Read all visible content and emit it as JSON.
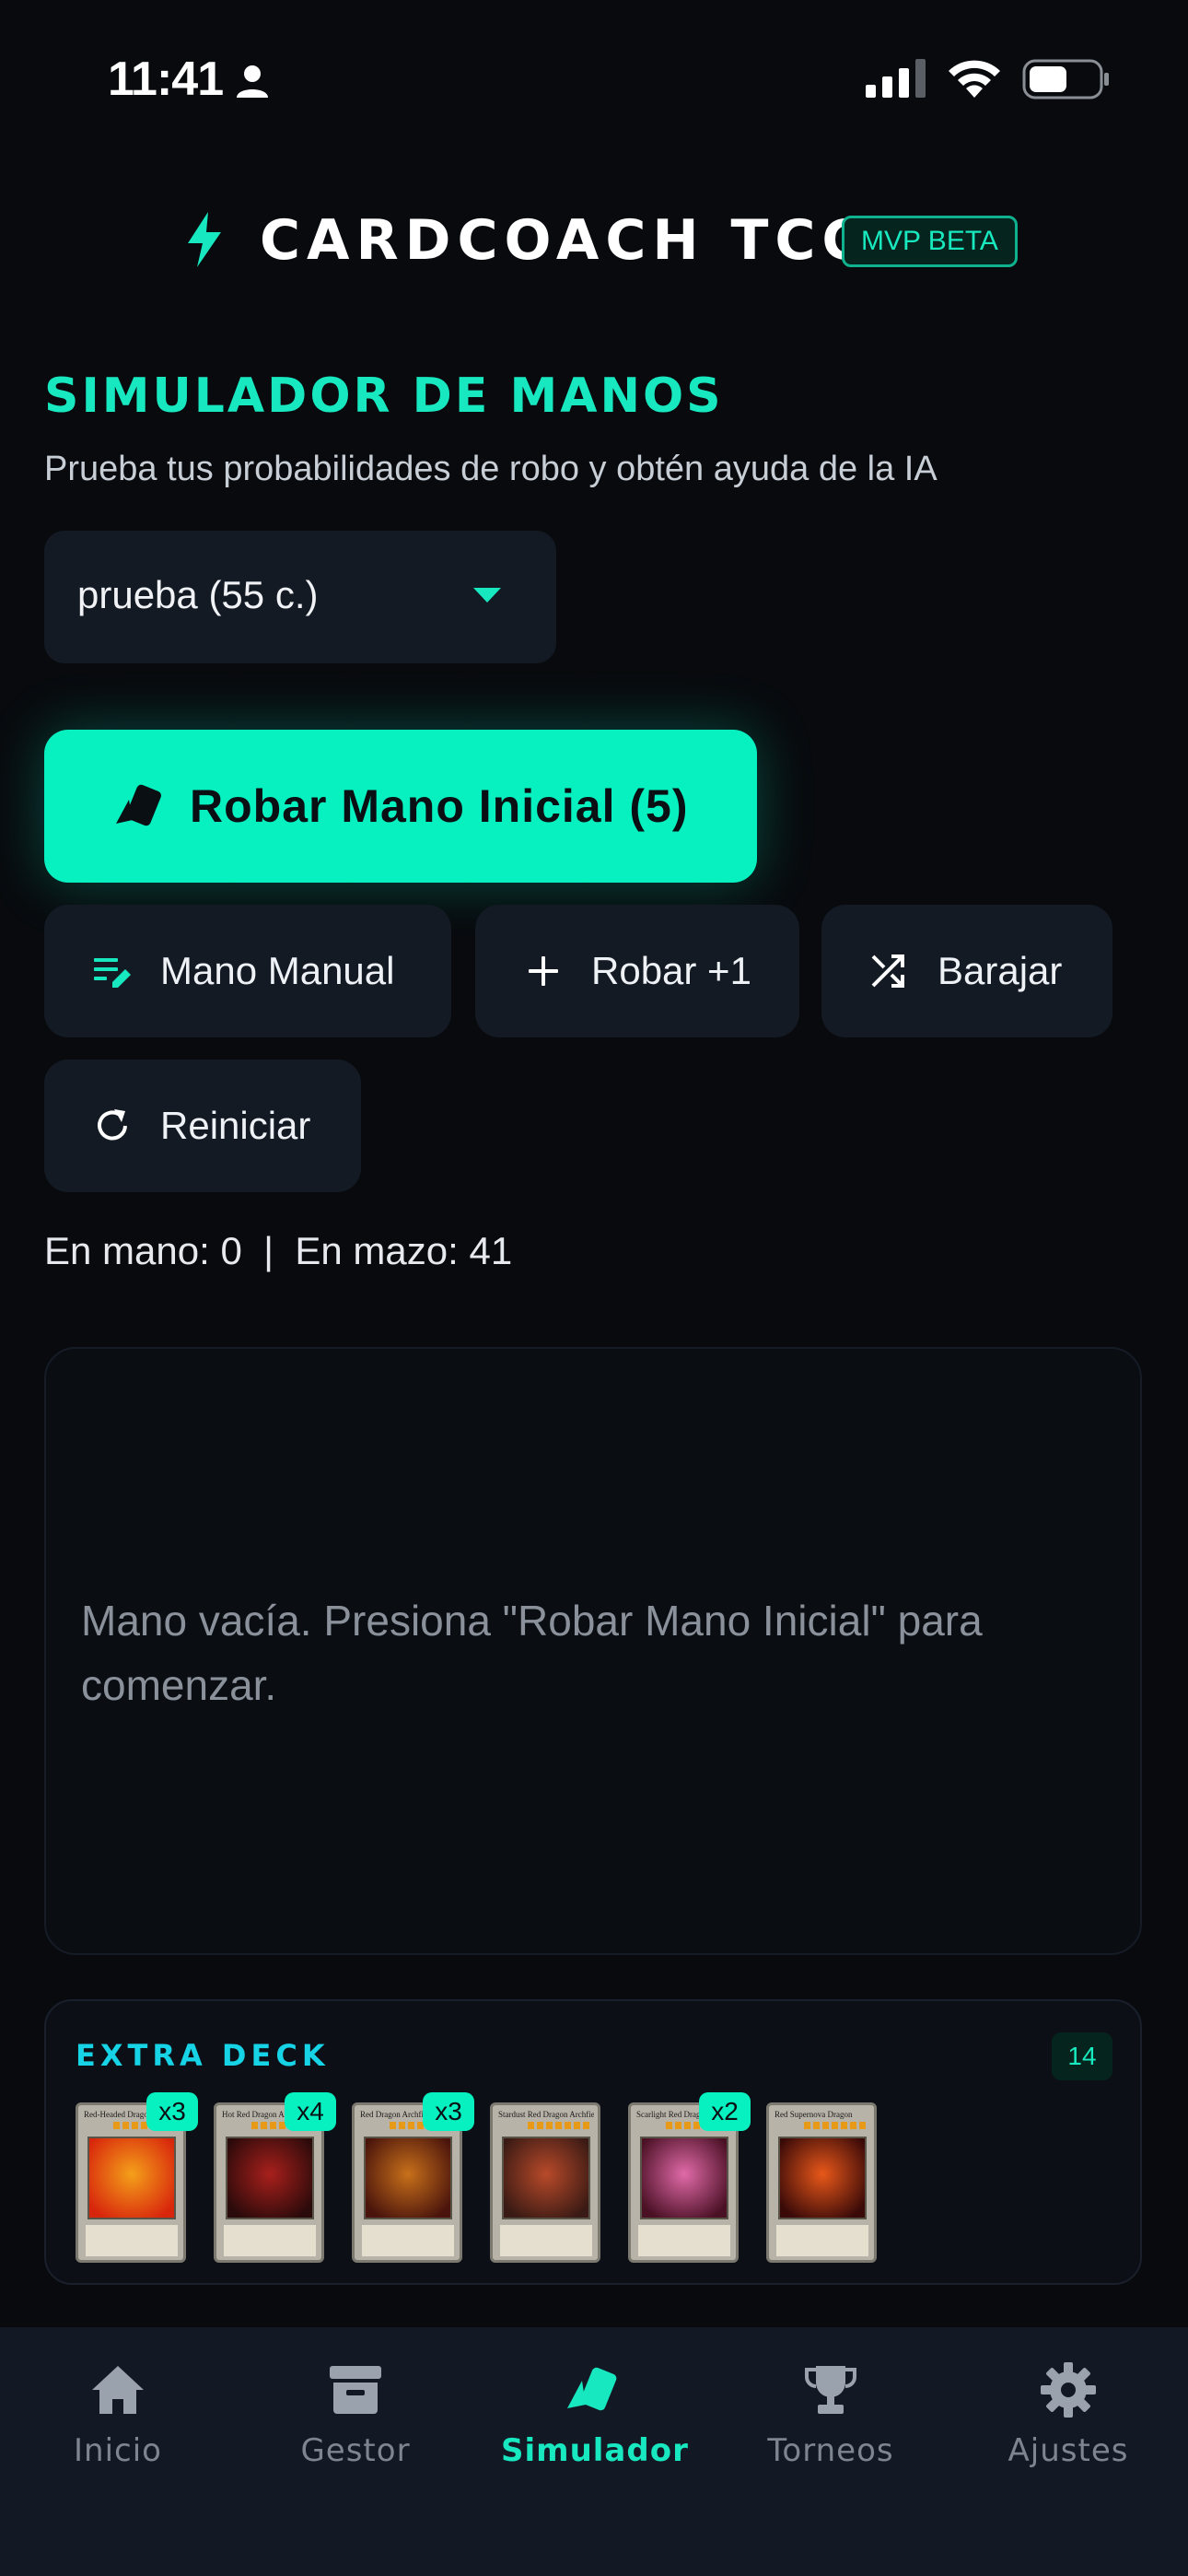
{
  "status_bar": {
    "time": "11:41"
  },
  "header": {
    "brand": "CARDCOACH TCG",
    "badge": "MVP BETA"
  },
  "page": {
    "title": "SIMULADOR DE MANOS",
    "subtitle": "Prueba tus probabilidades de robo y obtén ayuda de la IA"
  },
  "deck_select": {
    "value": "prueba (55 c.)"
  },
  "actions": {
    "draw_initial": "Robar Mano Inicial (5)",
    "manual_hand": "Mano Manual",
    "draw_one": "Robar +1",
    "shuffle": "Barajar",
    "reset": "Reiniciar"
  },
  "counts": {
    "text": "En mano: 0  |  En mazo: 41"
  },
  "hand": {
    "empty_message": "Mano vacía. Presiona \"Robar Mano Inicial\" para comenzar."
  },
  "extra_deck": {
    "title": "EXTRA DECK",
    "count": "14",
    "cards": [
      {
        "name": "Red-Headed Dragon",
        "qty": "x3",
        "art": [
          "#f4a01a",
          "#d8260c"
        ]
      },
      {
        "name": "Hot Red Dragon Archfiend",
        "qty": "x4",
        "art": [
          "#a8201c",
          "#2a0a0a"
        ]
      },
      {
        "name": "Red Dragon Archfiend",
        "qty": "x3",
        "art": [
          "#c8701a",
          "#4a140c"
        ]
      },
      {
        "name": "Stardust Red Dragon Archfiend",
        "qty": "",
        "art": [
          "#b84a2a",
          "#3a1a14"
        ]
      },
      {
        "name": "Scarlight Red Dragon Archfiend",
        "qty": "x2",
        "art": [
          "#e06aa8",
          "#4a1024"
        ]
      },
      {
        "name": "Red Supernova Dragon",
        "qty": "",
        "art": [
          "#e8581a",
          "#3a0a08"
        ]
      }
    ]
  },
  "nav": {
    "items": [
      {
        "label": "Inicio",
        "icon": "home-icon"
      },
      {
        "label": "Gestor",
        "icon": "archive-icon"
      },
      {
        "label": "Simulador",
        "icon": "cards-icon",
        "active": true
      },
      {
        "label": "Torneos",
        "icon": "trophy-icon"
      },
      {
        "label": "Ajustes",
        "icon": "gear-icon"
      }
    ]
  },
  "colors": {
    "accent": "#07f0c0",
    "background": "#080a0e",
    "surface": "#141a24",
    "nav_background": "#131924",
    "extra_title": "#17d3e6"
  }
}
